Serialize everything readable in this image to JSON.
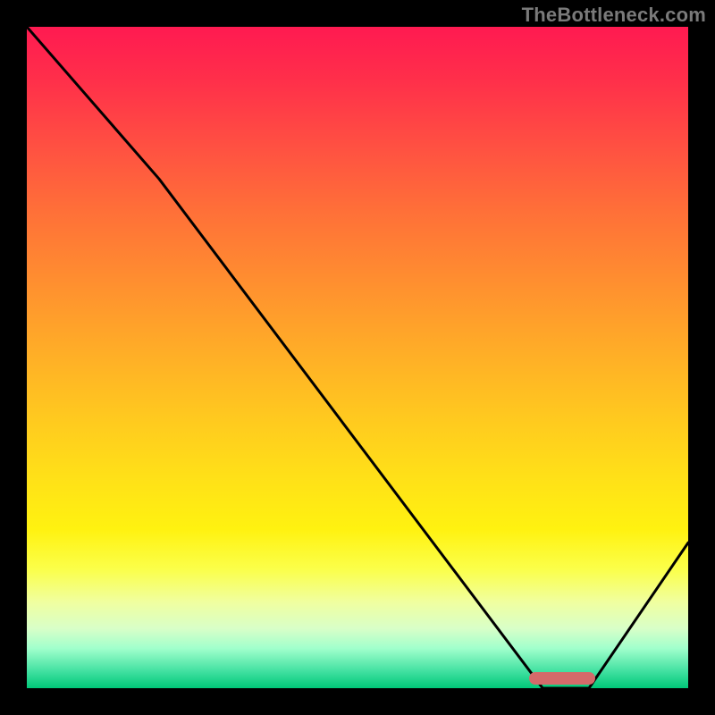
{
  "watermark": "TheBottleneck.com",
  "chart_data": {
    "type": "line",
    "title": "",
    "xlabel": "",
    "ylabel": "",
    "xlim": [
      0,
      100
    ],
    "ylim": [
      0,
      100
    ],
    "series": [
      {
        "name": "curve",
        "x": [
          0,
          20,
          78,
          85,
          100
        ],
        "y": [
          100,
          77,
          0,
          0,
          22
        ]
      }
    ],
    "marker": {
      "x_start": 76,
      "x_end": 86,
      "y": 1.5
    },
    "gradient_stops": [
      {
        "pct": 0,
        "color": "#ff1a51"
      },
      {
        "pct": 18,
        "color": "#ff5042"
      },
      {
        "pct": 48,
        "color": "#ffaa28"
      },
      {
        "pct": 76,
        "color": "#fff210"
      },
      {
        "pct": 91,
        "color": "#d8ffc8"
      },
      {
        "pct": 100,
        "color": "#00c878"
      }
    ]
  }
}
